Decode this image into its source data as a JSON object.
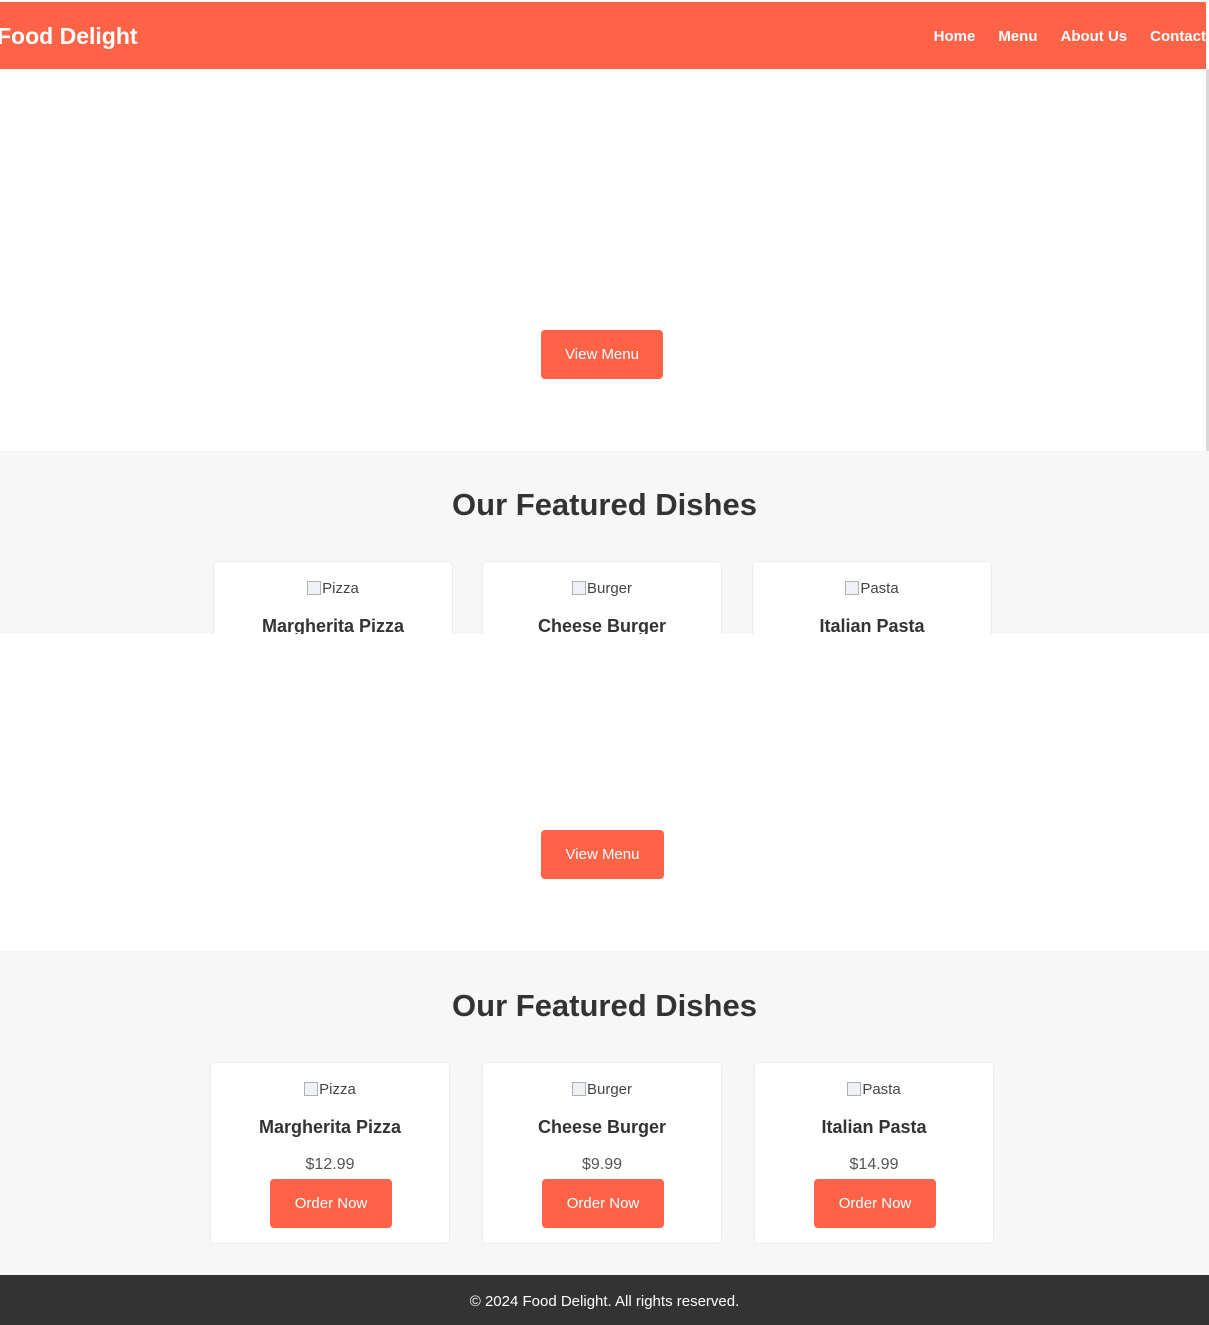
{
  "header": {
    "logo": "Food Delight",
    "nav": [
      "Home",
      "Menu",
      "About Us",
      "Contact"
    ]
  },
  "hero": {
    "button_label": "View Menu"
  },
  "featured": {
    "title": "Our Featured Dishes",
    "dishes": [
      {
        "alt": "Pizza",
        "name": "Margherita Pizza",
        "price": "$12.99",
        "button": "Order Now"
      },
      {
        "alt": "Burger",
        "name": "Cheese Burger",
        "price": "$9.99",
        "button": "Order Now"
      },
      {
        "alt": "Pasta",
        "name": "Italian Pasta",
        "price": "$14.99",
        "button": "Order Now"
      }
    ]
  },
  "footer": {
    "text": "© 2024 Food Delight. All rights reserved."
  },
  "colors": {
    "brand": "#ff6347",
    "footer_bg": "#333333",
    "section_bg": "#f7f7f7"
  }
}
